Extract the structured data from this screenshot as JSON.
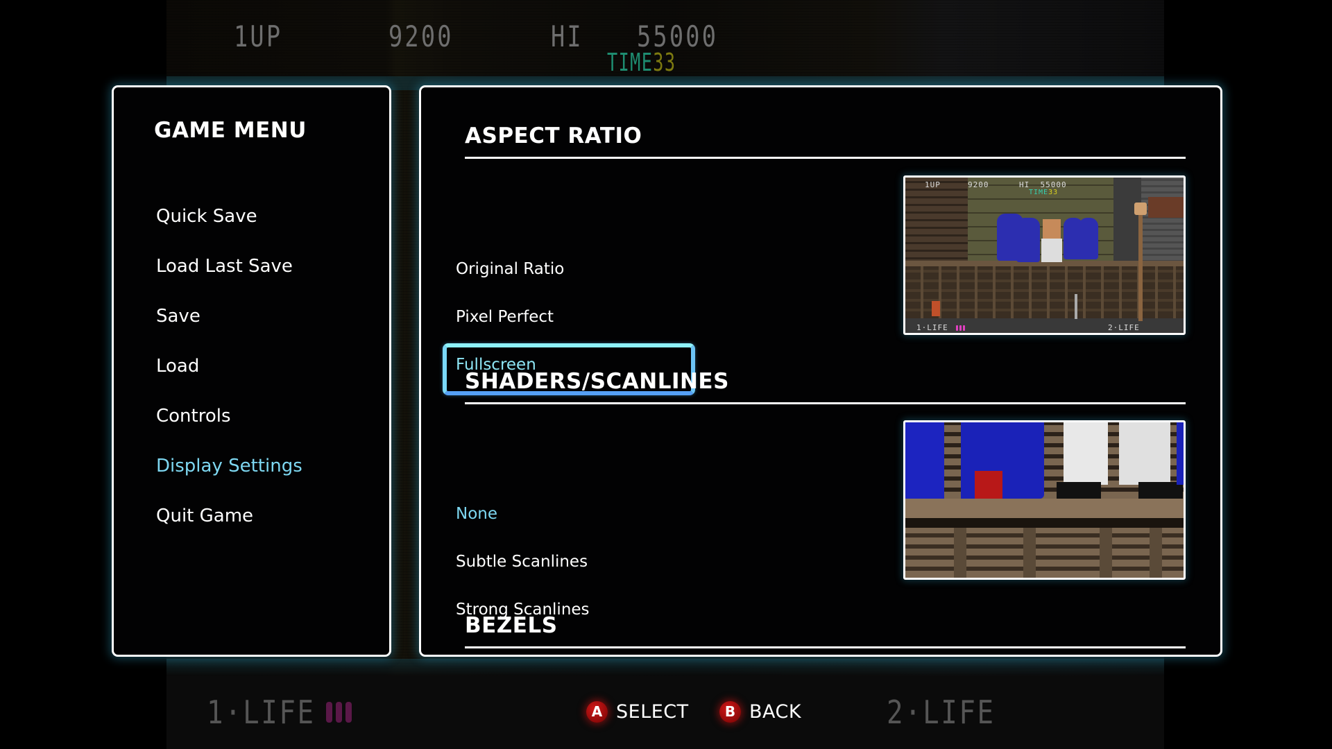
{
  "background": {
    "hud_top": {
      "player_label": "1UP",
      "score": "9200",
      "hi_label": "HI",
      "hi_score": "55000",
      "time_label": "TIME",
      "time_value": "33"
    },
    "hud_bottom": {
      "p1_label": "1·LIFE",
      "p1_lives": 3,
      "p2_label": "2·LIFE"
    }
  },
  "menu": {
    "title": "GAME MENU",
    "items": [
      {
        "label": "Quick Save"
      },
      {
        "label": "Load Last Save"
      },
      {
        "label": "Save"
      },
      {
        "label": "Load"
      },
      {
        "label": "Controls"
      },
      {
        "label": "Display Settings",
        "active": true
      },
      {
        "label": "Quit Game"
      }
    ]
  },
  "display_settings": {
    "aspect_ratio": {
      "title": "ASPECT RATIO",
      "options": [
        {
          "label": "Original Ratio"
        },
        {
          "label": "Pixel Perfect"
        },
        {
          "label": "Fullscreen",
          "focused": true
        }
      ],
      "preview": {
        "hud": {
          "player_label": "1UP",
          "score": "9200",
          "hi_label": "HI",
          "hi_score": "55000",
          "time_label": "TIME",
          "time_value": "33",
          "p1_label": "1·LIFE",
          "p2_label": "2·LIFE"
        }
      }
    },
    "shaders": {
      "title": "SHADERS/SCANLINES",
      "options": [
        {
          "label": "None",
          "selected": true
        },
        {
          "label": "Subtle Scanlines"
        },
        {
          "label": "Strong Scanlines"
        }
      ]
    },
    "bezels": {
      "title": "BEZELS"
    }
  },
  "hints": {
    "select": {
      "button": "A",
      "label": "SELECT"
    },
    "back": {
      "button": "B",
      "label": "BACK"
    }
  },
  "colors": {
    "accent": "#7ed8f2",
    "focus_border": "#6cc4f6",
    "panel_border": "#ffffff",
    "panel_glow": "#288caa",
    "button_red": "#c01010"
  }
}
